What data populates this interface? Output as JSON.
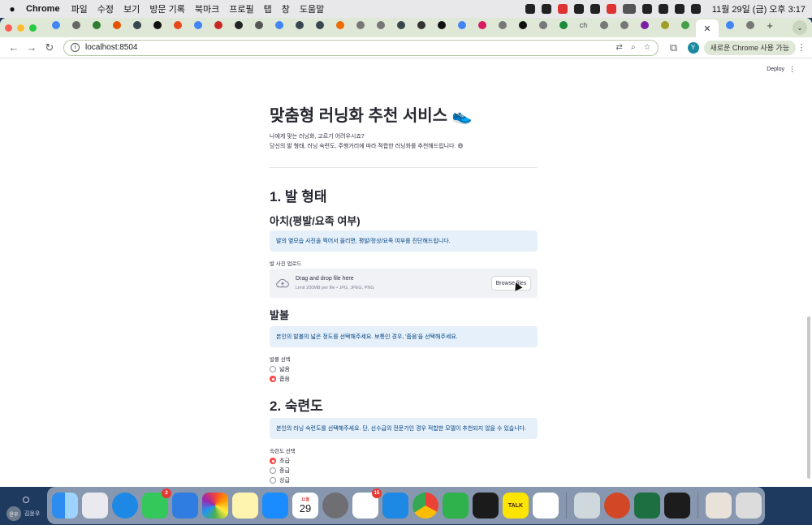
{
  "menubar": {
    "app": "Chrome",
    "items": [
      "파일",
      "수정",
      "보기",
      "방문 기록",
      "북마크",
      "프로필",
      "탭",
      "창",
      "도움말"
    ],
    "clock": "11월 29일 (금) 오후 3:17"
  },
  "browser": {
    "url": "localhost:8504",
    "update_label": "새로운 Chrome 사용 가능",
    "profile_initial": "Y",
    "tab_labels": [
      "ch"
    ]
  },
  "app": {
    "deploy_label": "Deploy",
    "title": "맞춤형 러닝화 추천 서비스 👟",
    "intro_line1": "나에게 맞는 러닝화, 고르기 어려우시죠?",
    "intro_line2": "당신의 발 형태, 러닝 숙련도, 주행거리에 따라 적합한 러닝화를 추천해드립니다. 😄",
    "section1": {
      "heading": "1. 발 형태",
      "arch_heading": "아치(평발/요족 여부)",
      "arch_info": "발의 옆모습 사진을 찍어서 올리면, 평발/정상/요족 여부를 진단해드립니다.",
      "upload_label": "발 사진 업로드",
      "upload": {
        "drag_text": "Drag and drop file here",
        "limit_text": "Limit 200MB per file • JPG, JPEG, PNG",
        "browse_label": "Browse files"
      },
      "width_heading": "발볼",
      "width_info": "본인의 발볼의 넓은 정도를 선택해주세요. 보통인 경우, '좁음'을 선택해주세요.",
      "width_select_label": "발볼 선택",
      "width_options": [
        {
          "label": "넓음",
          "selected": false
        },
        {
          "label": "좁음",
          "selected": true
        }
      ]
    },
    "section2": {
      "heading": "2. 숙련도",
      "info": "본인의 러닝 숙련도를 선택해주세요. 단, 선수급의 전문가인 경우 적합한 모델이 추천되지 않을 수 있습니다.",
      "select_label": "숙련도 선택",
      "options": [
        {
          "label": "초급",
          "selected": true
        },
        {
          "label": "중급",
          "selected": false
        },
        {
          "label": "상급",
          "selected": false
        }
      ]
    }
  },
  "desktop": {
    "user_badge": "윤우",
    "user_name": "김윤우"
  },
  "dock": {
    "badges": {
      "messages": "2",
      "calendar_day": "29",
      "calendar_month": "11월",
      "reminders": "15"
    },
    "kakao_label": "TALK"
  },
  "colors": {
    "accent": "#ff4b4b",
    "info_bg": "#e6f0fb",
    "info_text": "#004280",
    "tabbar": "#dfe8d6"
  }
}
